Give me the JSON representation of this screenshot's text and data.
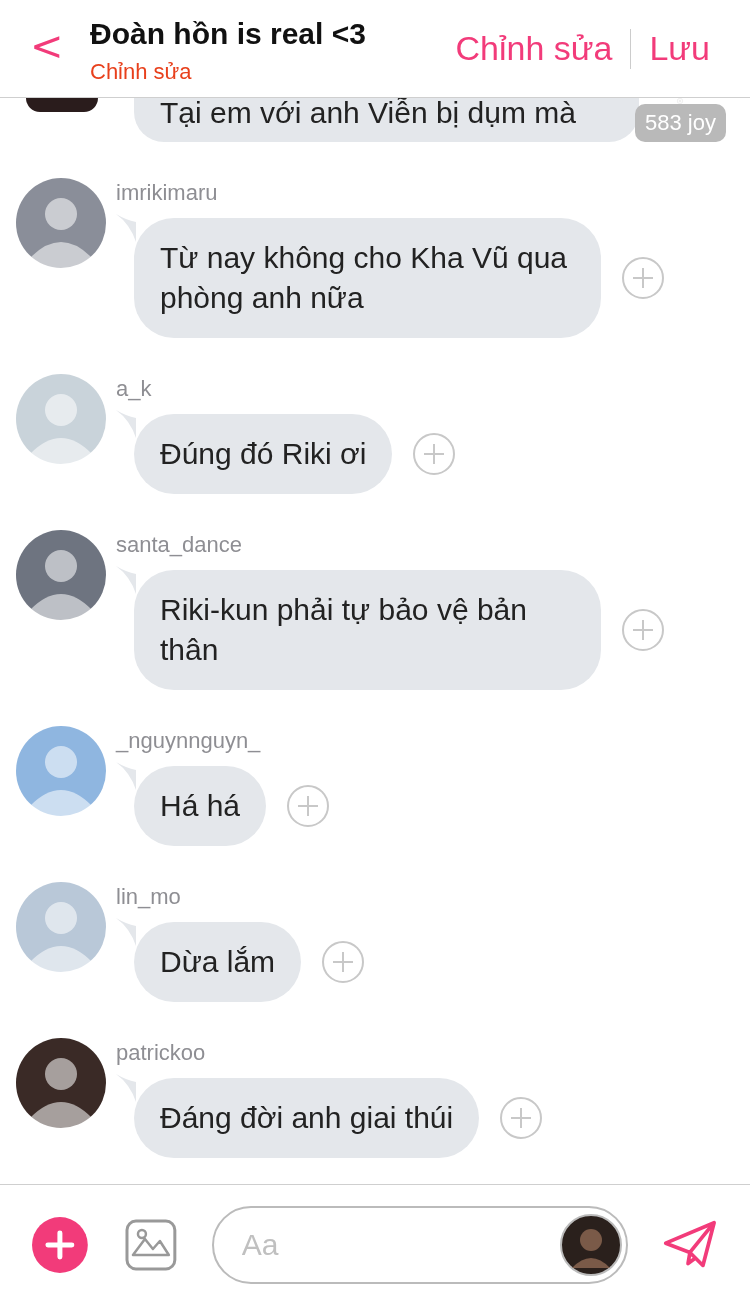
{
  "header": {
    "back": "<",
    "title": "Đoàn hồn is real <3",
    "subtitle": "Chỉnh sửa",
    "actions": [
      "Chỉnh sửa",
      "Lưu"
    ]
  },
  "partial_message": {
    "text": "Tại em với anh Viễn bị dụm mà",
    "badge": "583 joy"
  },
  "messages": [
    {
      "user": "imrikimaru",
      "text": "Từ nay không cho Kha Vũ qua phòng anh nữa",
      "color": "#8a8e99"
    },
    {
      "user": "a_k",
      "text": "Đúng đó Riki ơi",
      "color": "#c9d3da"
    },
    {
      "user": "santa_dance",
      "text": "Riki-kun phải tự bảo vệ bản thân",
      "color": "#6e7480"
    },
    {
      "user": "_nguynnguyn_",
      "text": "Há há",
      "color": "#8fb6e0"
    },
    {
      "user": "lin_mo",
      "text": "Dừa lắm",
      "color": "#b9c8d8"
    },
    {
      "user": "patrickoo",
      "text": "Đáng đời anh giai thúi",
      "color": "#3a2a26"
    }
  ],
  "composer": {
    "placeholder": "Aa"
  }
}
